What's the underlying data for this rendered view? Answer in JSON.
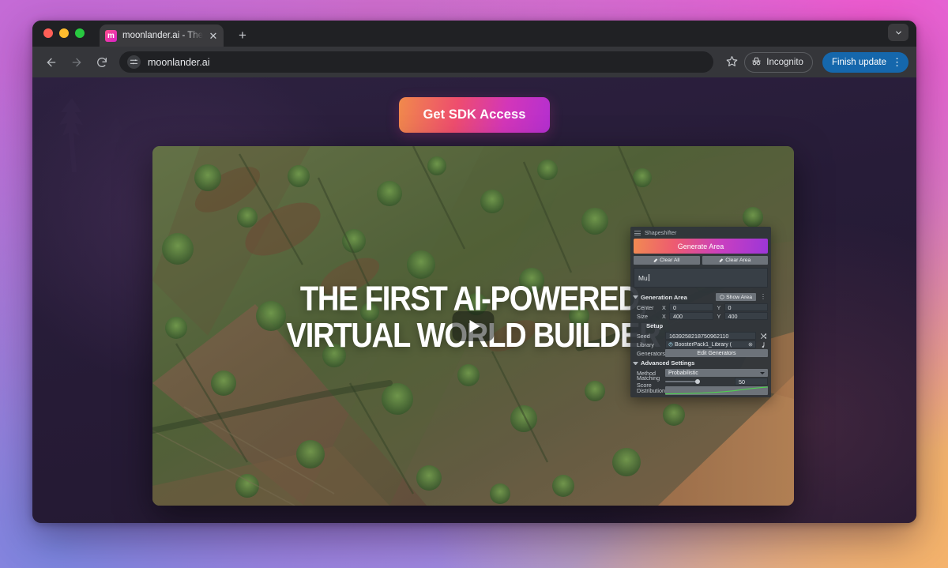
{
  "browser": {
    "tab": {
      "favicon_letter": "m",
      "title": "moonlander.ai - The first AI c",
      "close_icon": "close-icon",
      "new_tab_icon": "plus-icon"
    },
    "toolbar": {
      "back_icon": "back-arrow-icon",
      "forward_icon": "forward-arrow-icon",
      "reload_icon": "reload-icon",
      "site_info_icon": "tune-icon",
      "url": "moonlander.ai",
      "bookmark_icon": "star-icon",
      "incognito_label": "Incognito",
      "incognito_icon": "incognito-hat-icon",
      "finish_update_label": "Finish update",
      "menu_icon": "kebab-menu-icon",
      "tab_list_icon": "chevron-down-icon"
    }
  },
  "page": {
    "cta_label": "Get SDK Access",
    "headline_line1": "THE FIRST AI-POWERED,",
    "headline_line2": "VIRTUAL WORLD BUILDER",
    "play_icon": "play-icon"
  },
  "panel": {
    "title": "Shapeshifter",
    "grip_icon": "drag-grip-icon",
    "generate_label": "Generate Area",
    "clear_all_label": "Clear All",
    "clear_area_label": "Clear Area",
    "clear_icon": "eraser-icon",
    "prompt_value": "Mu",
    "generation_area": {
      "section_label": "Generation Area",
      "show_area_label": "Show Area",
      "show_area_icon": "cube-icon",
      "options_icon": "kebab-menu-icon",
      "center_label": "Center",
      "center_x_axis": "X",
      "center_x": "0",
      "center_y_axis": "Y",
      "center_y": "0",
      "size_label": "Size",
      "size_x_axis": "X",
      "size_x": "400",
      "size_y_axis": "Y",
      "size_y": "400"
    },
    "setup": {
      "section_label": "Setup",
      "seed_label": "Seed",
      "seed_value": "1639258218750962110",
      "seed_shuffle_icon": "shuffle-icon",
      "library_label": "Library",
      "library_value": "BoosterPack1_Library (",
      "library_asset_icon": "asset-icon",
      "library_target_icon": "target-icon",
      "library_revert_icon": "revert-arrow-icon",
      "generators_label": "Generators",
      "edit_generators_label": "Edit Generators"
    },
    "advanced": {
      "section_label": "Advanced Settings",
      "method_label": "Method",
      "method_value": "Probabilistic",
      "method_caret_icon": "dropdown-caret-icon",
      "matching_score_label": "Matching Score",
      "matching_score_value": "50",
      "distribution_label": "Distribution",
      "distribution_curve_icon": "curve-graph-icon"
    }
  },
  "colors": {
    "accent_start": "#f08a4b",
    "accent_mid": "#ee4d6e",
    "accent_end": "#b42fd0",
    "update_blue": "#1567ac",
    "curve_green": "#4fd14f"
  }
}
